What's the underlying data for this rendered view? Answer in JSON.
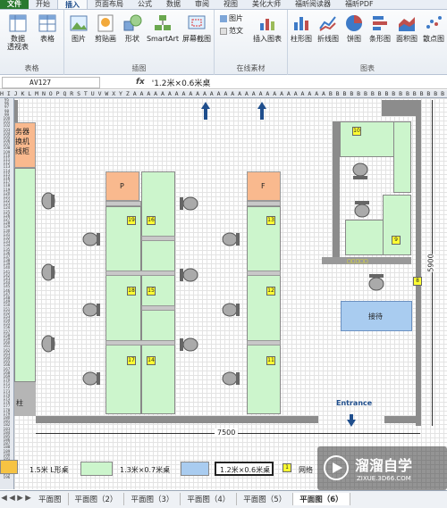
{
  "ribbon_tabs": [
    "文件",
    "开始",
    "插入",
    "页面布局",
    "公式",
    "数据",
    "审阅",
    "视图",
    "美化大师",
    "福昕阅读器",
    "福昕PDF"
  ],
  "active_tab": "插入",
  "ribbon": {
    "table_group": {
      "label": "表格",
      "pivot": "数据\n透视表",
      "table": "表格"
    },
    "illustrations_group": {
      "label": "插图",
      "picture": "图片",
      "clipart": "剪贴画",
      "shapes": "形状",
      "smartart": "SmartArt",
      "screenshot": "屏幕截图"
    },
    "online_group": {
      "label": "在线素材",
      "pic": "图片",
      "template": "范文",
      "insert_chart": "插入图表"
    },
    "charts_group": {
      "label": "图表",
      "column": "柱形图",
      "line": "折线图",
      "pie": "饼图",
      "bar": "条形图",
      "area": "面积图",
      "scatter": "散点图"
    }
  },
  "formula_bar": {
    "name_box": "AV127",
    "fx": "fx",
    "formula": "'1.2米×0.6米桌"
  },
  "column_header_text": "H I J K L M N O P Q R S T U V W X Y Z A A A A A A A A A A A A A A A A A A A A A A A A A A A A B B B B B B B B B B B B B B B B B B B B B B B B B B B B B B B B B B C C C C C C C C C C C C C C C",
  "rows_start": 95,
  "rows_end": 128,
  "floor": {
    "left_block_text": "务器\n换机\n线柜",
    "left_bottom_text": "柱",
    "desk_orange_p": "P",
    "desk_orange_f": "F",
    "desk_numbers": [
      "19",
      "16",
      "18",
      "15",
      "17",
      "14",
      "13",
      "12",
      "11",
      "10",
      "9",
      "8"
    ],
    "reception": "接待",
    "entrance": "Entrance",
    "width_dim": "7500",
    "height_dim": "5900"
  },
  "legend": {
    "l1": "1.5米 L形桌",
    "l2": "1.3米×0.7米桌",
    "l3": "1.2米×0.6米桌",
    "l4_num": "1",
    "l4_text": "网络"
  },
  "sheet_tabs": [
    "平面图",
    "平面图（2）",
    "平面图（3）",
    "平面图（4）",
    "平面图（5）",
    "平面图（6）"
  ],
  "active_sheet": "平面图（6）",
  "watermark": {
    "title": "溜溜自学",
    "url": "ZIXUE.3D66.COM"
  },
  "colors": {
    "desk": "#ccf5cc",
    "orange": "#f9b98e",
    "wall": "#8c8c8c",
    "blue": "#a9ccf0",
    "yellow": "#ffff33",
    "accent": "#2a7a2f"
  }
}
